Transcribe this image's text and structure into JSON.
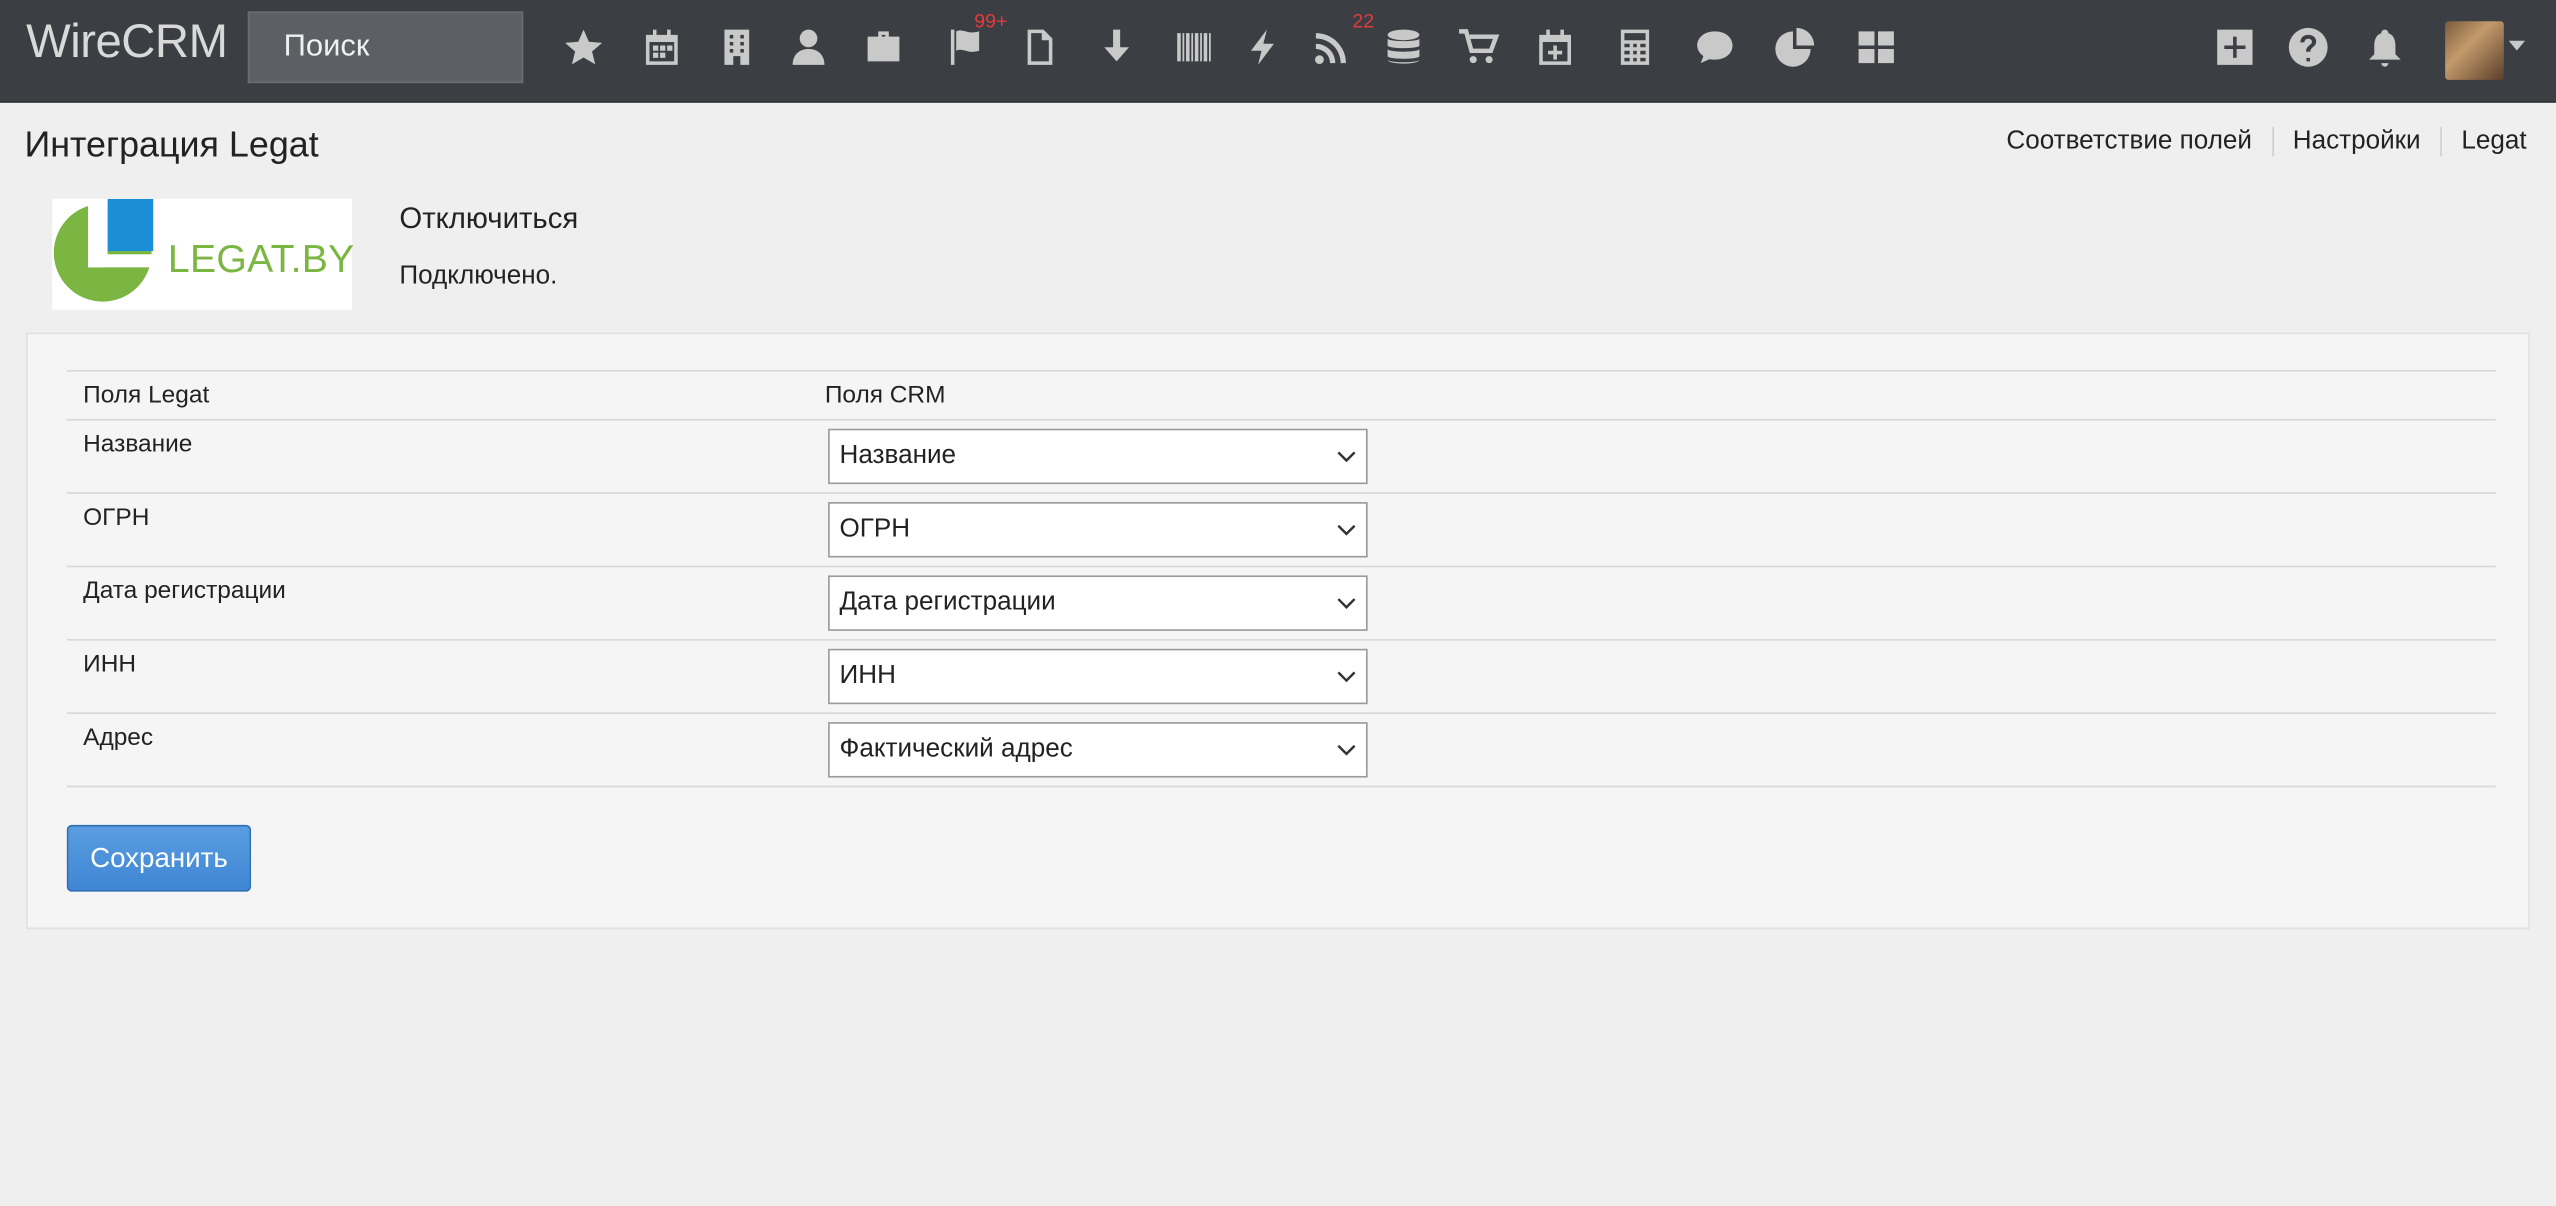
{
  "app": {
    "brand": "WireCRM"
  },
  "search": {
    "placeholder": "Поиск"
  },
  "nav": {
    "icons": [
      "star-icon",
      "calendar-icon",
      "building-icon",
      "user-icon",
      "briefcase-icon",
      "flag-icon",
      "document-icon",
      "download-icon",
      "barcode-icon",
      "lightning-icon",
      "rss-icon",
      "database-icon",
      "cart-icon",
      "calendar-plus-icon",
      "calculator-icon",
      "chat-icon",
      "pie-chart-icon",
      "grid-icon"
    ],
    "flag_badge": "99+",
    "rss_badge": "22",
    "right_icons": [
      "plus-square-icon",
      "help-icon",
      "bell-icon"
    ]
  },
  "header": {
    "title": "Интеграция Legat",
    "tabs": [
      {
        "label": "Соответствие полей"
      },
      {
        "label": "Настройки"
      },
      {
        "label": "Legat"
      }
    ]
  },
  "integration": {
    "logo_text": "LEGAT.BY",
    "disconnect_label": "Отключиться",
    "status": "Подключено."
  },
  "mapping": {
    "col_legat": "Поля Legat",
    "col_crm": "Поля CRM",
    "rows": [
      {
        "legat": "Название",
        "crm": "Название"
      },
      {
        "legat": "ОГРН",
        "crm": "ОГРН"
      },
      {
        "legat": "Дата регистрации",
        "crm": "Дата регистрации"
      },
      {
        "legat": "ИНН",
        "crm": "ИНН"
      },
      {
        "legat": "Адрес",
        "crm": "Фактический адрес"
      }
    ]
  },
  "actions": {
    "save_label": "Сохранить"
  },
  "colors": {
    "topbar": "#3b3e42",
    "accent": "#3f86d4",
    "logo_green": "#7bb542",
    "logo_blue": "#1a8ed6",
    "badge": "#e43a3a"
  }
}
